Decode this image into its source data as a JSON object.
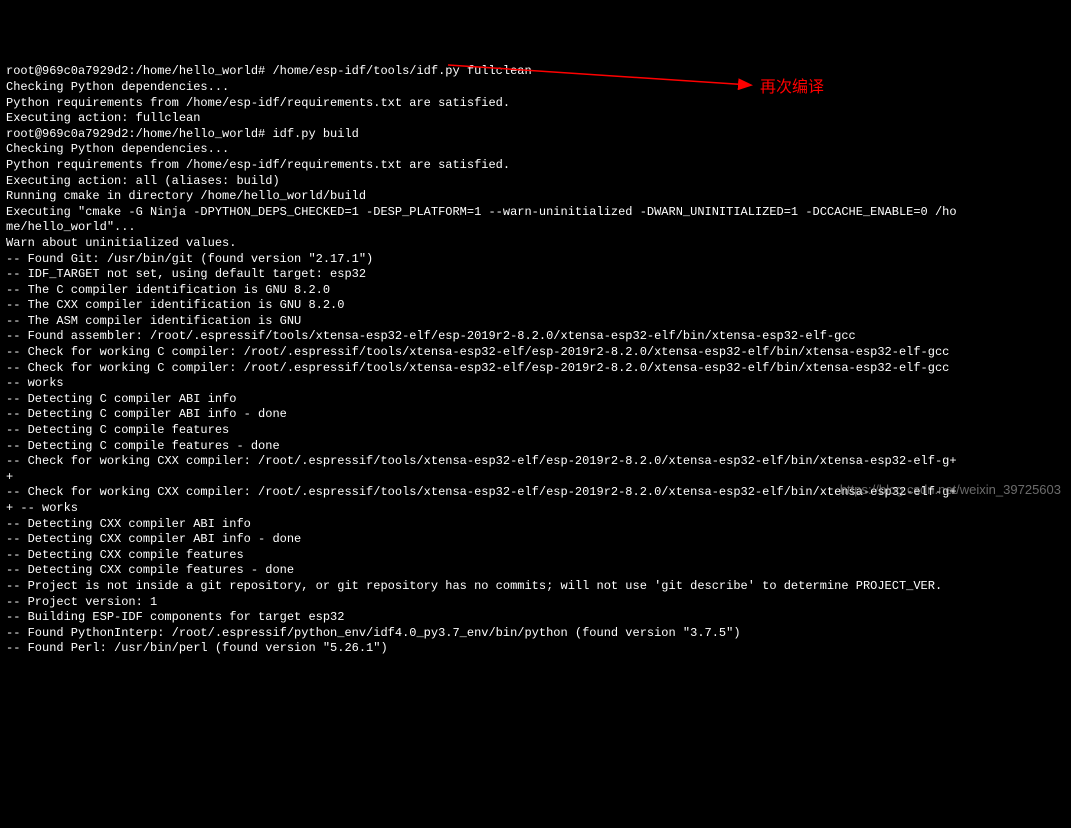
{
  "terminal": {
    "lines": [
      "root@969c0a7929d2:/home/hello_world# /home/esp-idf/tools/idf.py fullclean",
      "Checking Python dependencies...",
      "Python requirements from /home/esp-idf/requirements.txt are satisfied.",
      "Executing action: fullclean",
      "root@969c0a7929d2:/home/hello_world# idf.py build",
      "Checking Python dependencies...",
      "Python requirements from /home/esp-idf/requirements.txt are satisfied.",
      "Executing action: all (aliases: build)",
      "Running cmake in directory /home/hello_world/build",
      "Executing \"cmake -G Ninja -DPYTHON_DEPS_CHECKED=1 -DESP_PLATFORM=1 --warn-uninitialized -DWARN_UNINITIALIZED=1 -DCCACHE_ENABLE=0 /ho",
      "me/hello_world\"...",
      "Warn about uninitialized values.",
      "-- Found Git: /usr/bin/git (found version \"2.17.1\")",
      "-- IDF_TARGET not set, using default target: esp32",
      "-- The C compiler identification is GNU 8.2.0",
      "-- The CXX compiler identification is GNU 8.2.0",
      "-- The ASM compiler identification is GNU",
      "-- Found assembler: /root/.espressif/tools/xtensa-esp32-elf/esp-2019r2-8.2.0/xtensa-esp32-elf/bin/xtensa-esp32-elf-gcc",
      "-- Check for working C compiler: /root/.espressif/tools/xtensa-esp32-elf/esp-2019r2-8.2.0/xtensa-esp32-elf/bin/xtensa-esp32-elf-gcc",
      "-- Check for working C compiler: /root/.espressif/tools/xtensa-esp32-elf/esp-2019r2-8.2.0/xtensa-esp32-elf/bin/xtensa-esp32-elf-gcc",
      "-- works",
      "-- Detecting C compiler ABI info",
      "-- Detecting C compiler ABI info - done",
      "-- Detecting C compile features",
      "-- Detecting C compile features - done",
      "-- Check for working CXX compiler: /root/.espressif/tools/xtensa-esp32-elf/esp-2019r2-8.2.0/xtensa-esp32-elf/bin/xtensa-esp32-elf-g+",
      "+",
      "-- Check for working CXX compiler: /root/.espressif/tools/xtensa-esp32-elf/esp-2019r2-8.2.0/xtensa-esp32-elf/bin/xtensa-esp32-elf-g+",
      "+ -- works",
      "-- Detecting CXX compiler ABI info",
      "-- Detecting CXX compiler ABI info - done",
      "-- Detecting CXX compile features",
      "-- Detecting CXX compile features - done",
      "-- Project is not inside a git repository, or git repository has no commits; will not use 'git describe' to determine PROJECT_VER.",
      "-- Project version: 1",
      "-- Building ESP-IDF components for target esp32",
      "-- Found PythonInterp: /root/.espressif/python_env/idf4.0_py3.7_env/bin/python (found version \"3.7.5\")",
      "-- Found Perl: /usr/bin/perl (found version \"5.26.1\")"
    ]
  },
  "annotation": {
    "text": "再次编译"
  },
  "watermark": {
    "text": "https://blog.csdn.net/weixin_39725603"
  }
}
